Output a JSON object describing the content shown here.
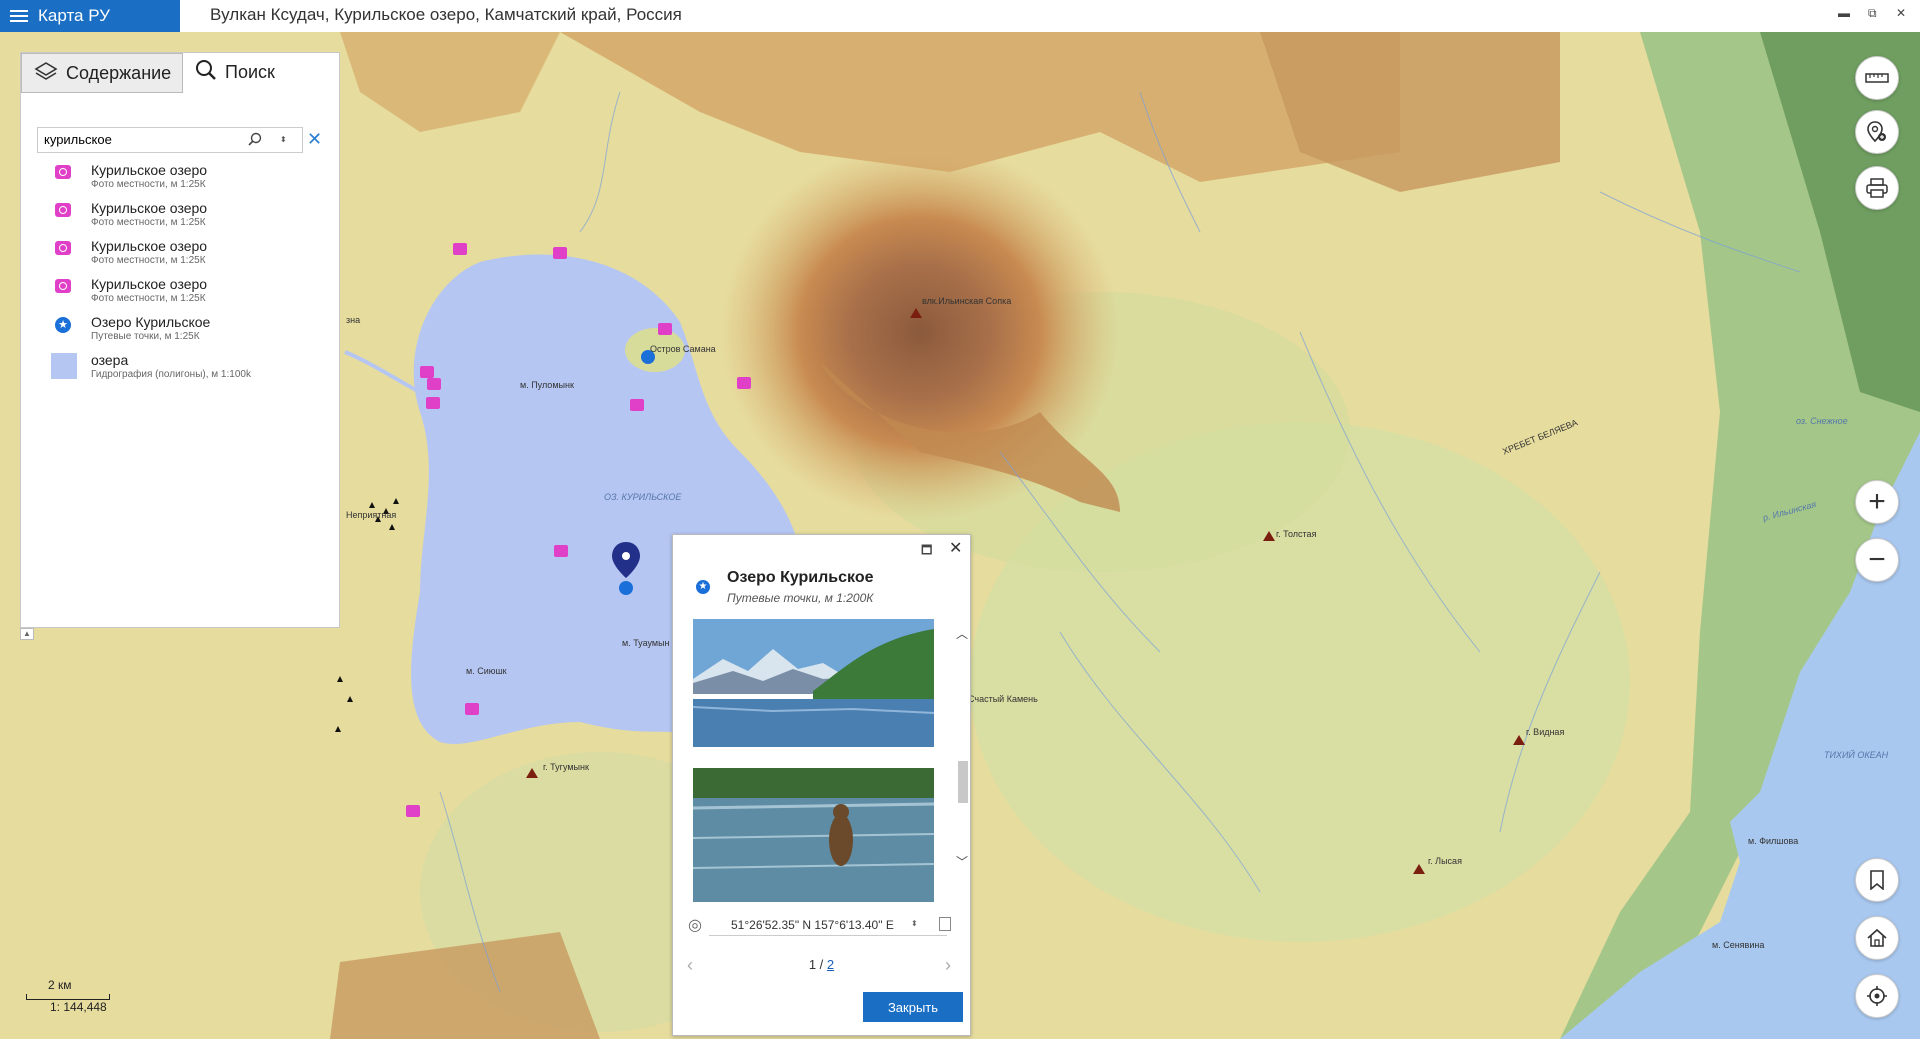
{
  "app": {
    "name": "Карта РУ"
  },
  "window": {
    "title": "Вулкан Ксудач, Курильское озеро, Камчатский край, Россия",
    "minimize": "▬",
    "restore": "⧉",
    "close": "✕"
  },
  "panel": {
    "tabs": [
      {
        "label": "Содержание",
        "icon": "layers-icon"
      },
      {
        "label": "Поиск",
        "icon": "search-icon"
      }
    ],
    "search": {
      "value": "курильское",
      "placeholder": ""
    },
    "results": [
      {
        "title": "Курильское озеро",
        "subtitle": "Фото местности, м 1:25К",
        "icon": "camera-icon"
      },
      {
        "title": "Курильское озеро",
        "subtitle": "Фото местности, м 1:25К",
        "icon": "camera-icon"
      },
      {
        "title": "Курильское озеро",
        "subtitle": "Фото местности, м 1:25К",
        "icon": "camera-icon"
      },
      {
        "title": "Курильское озеро",
        "subtitle": "Фото местности, м 1:25К",
        "icon": "camera-icon"
      },
      {
        "title": "Озеро Курильское",
        "subtitle": "Путевые точки, м 1:25К",
        "icon": "waypoint-star-icon"
      },
      {
        "title": "озера",
        "subtitle": "Гидрография (полигоны), м 1:100k",
        "icon": "lake-polygon-icon"
      }
    ]
  },
  "scale": {
    "distance": "2 км",
    "ratio": "1: 144,448"
  },
  "map_labels": {
    "volcano": "влк.Ильинская Сопка",
    "island": "Остров Самана",
    "lake": "ОЗ. КУРИЛЬСКОЕ",
    "pulomynk": "м. Пуломынк",
    "nepriyatnaya": "Неприятная",
    "tuyumyn": "м. Туаумын",
    "siyushk": "м. Сиюшк",
    "tugumynk": "г. Тугумынк",
    "kamen": "Счастый Камень",
    "tolstaya": "г. Толстая",
    "ridge": "ХРЕБЕТ БЕЛЯЕВА",
    "vidnaya": "г. Видная",
    "ocean": "ТИХИЙ ОКЕАН",
    "lysaya": "г. Лысая",
    "filshova": "м. Филшова",
    "senyavina": "м. Сенявина",
    "snezhnoe": "оз. Снежное",
    "ilinskaya": "р. Ильинская",
    "na": "зна"
  },
  "popup": {
    "title": "Озеро Курильское",
    "subtitle": "Путевые точки, м 1:200К",
    "coords": "51°26'52.35\" N 157°6'13.40\" E",
    "page_current": "1 /",
    "page_total": "2",
    "close_button": "Закрыть"
  },
  "colors": {
    "accent": "#1a6fc4",
    "lake": "#b6c6f2",
    "photo_marker": "#e040c8",
    "waypoint": "#1a6fd8"
  }
}
